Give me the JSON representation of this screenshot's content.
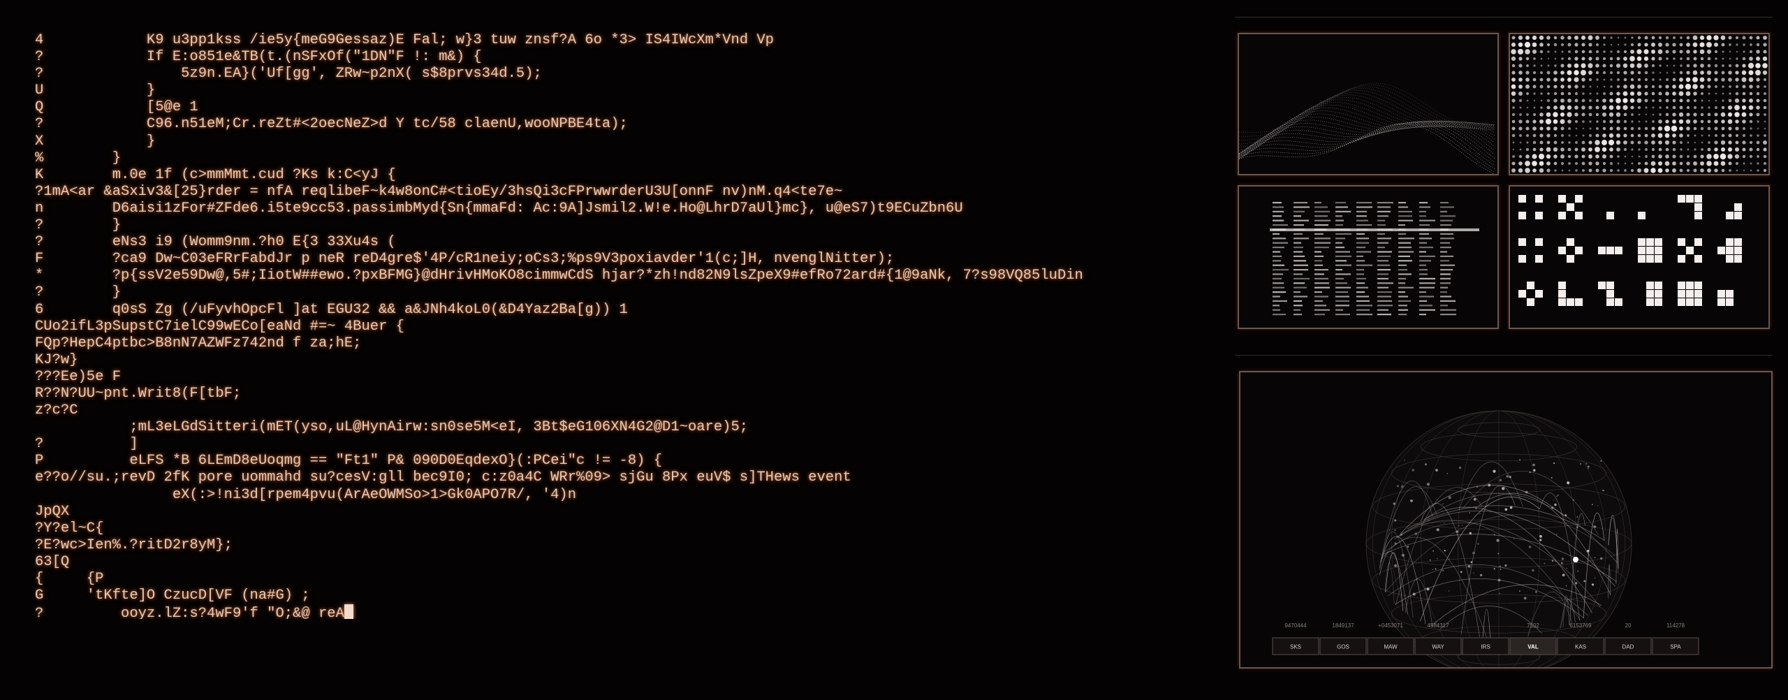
{
  "terminal": {
    "lines": [
      "4            K9 u3pp1kss /ie5y{meG9Gessaz)E Fal; w}3 tuw znsf?A 6o *3> IS4IWcXm*Vnd Vp",
      "?            If E:o851e&TB(t.(nSFxOf(\"1DN\"F !: m&) {",
      "?                5z9n.EA}('Uf[gg', ZRw~p2nX( s$8prvs34d.5);",
      "U            }",
      "Q            [5@e 1",
      "?            C96.n51eM;Cr.reZt#<2oecNeZ>d Y tc/58 claenU,wooNPBE4ta);",
      "X            }",
      "%        }",
      "K        m.0e 1f (c>mmMmt.cud ?Ks k:C<yJ {",
      "?1mA<ar &aSxiv3&[25}rder = nfA reqlibeF~k4w8onC#<tioEy/3hsQi3cFPrwwrderU3U[onnF nv)nM.q4<te7e~",
      "n        D6aisi1zFor#ZFde6.i5te9cc53.passimbMyd{Sn{mmaFd: Ac:9A]Jsmil2.W!e.Ho@LhrD7aUl}mc}, u@eS7)t9ECuZbn6U",
      "?        }",
      "?        eNs3 i9 (Womm9nm.?h0 E{3 33Xu4s (",
      "F        ?ca9 Dw~C03eFRrFabdJr p neR reD4gre$'4P/cR1neiy;oCs3;%ps9V3poxiavder'1(c;]H, nvenglNitter);",
      "*        ?p{ssV2e59Dw@,5#;IiotW##ewo.?pxBFMG}@dHrivHMoKO8cimmwCdS hjar?*zh!nd82N9lsZpeX9#efRo72ard#{1@9aNk, 7?s98VQ85luDin",
      "?        }",
      "6        q0sS Zg (/uFyvhOpcFl ]at EGU32 && a&JNh4koL0(&D4Yaz2Ba[g)) 1",
      "CUo2ifL3pSupstC7ielC99wECo[eaNd #=~ 4Buer {",
      "FQp?HepC4ptbc>B8nN7AZWFz742nd f za;hE;",
      "KJ?w}",
      "???Ee)5e F",
      "R??N?UU~pnt.Writ8(F[tbF;",
      "z?c?C",
      "           ;mL3eLGdSitteri(mET(yso,uL@HynAirw:sn0se5M<eI, 3Bt$eG106XN4G2@D1~oare)5;",
      "?          ]",
      "P          eLFS *B 6LEmD8eUoqmg == \"Ft1\" P& 090D0EqdexO}(:PCei\"c != -8) {",
      "e??o//su.;revD 2fK pore uommahd su?cesV:gll bec9I0; c:z0a4C WRr%09> sjGu 8Px euV$ s]THews event",
      "                eX(:>!ni3d[rpem4pvu(ArAeOWMSo>1>Gk0APO7R/, '4)n",
      "JpQX",
      "?Y?el~C{",
      "?E?wc>Ien%.?ritD2r8yM};",
      "63[Q",
      "{     {P",
      "G     'tKfte]O CzucD[VF (na#G) ;",
      "?         ooyz.lZ:s?4wF9'f \"O;&@ reA"
    ]
  },
  "globe_panel": {
    "stats": [
      "9470444",
      "1849137",
      "+0453071",
      "4584317",
      "",
      "7502",
      "6153769",
      "20",
      "114278"
    ],
    "buttons": [
      "SKS",
      "GOS",
      "MAW",
      "WAY",
      "IRS",
      "VAL",
      "KAS",
      "DAD",
      "SPA"
    ],
    "selected_button": "VAL"
  },
  "colors": {
    "text": "#e8c9b4",
    "glow": "#ff9a5a",
    "panel_border": "#6a5750"
  }
}
